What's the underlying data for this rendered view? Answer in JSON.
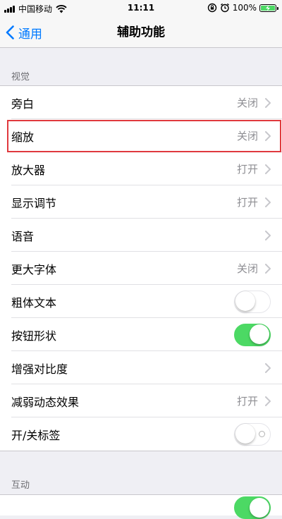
{
  "status_bar": {
    "carrier": "中国移动",
    "time": "11:11",
    "battery_percent": "100%",
    "icons": [
      "signal-icon",
      "wifi-icon",
      "rotation-lock-icon",
      "alarm-icon",
      "battery-charging-icon"
    ]
  },
  "nav": {
    "back_label": "通用",
    "title": "辅助功能"
  },
  "sections": {
    "vision_header": "视觉",
    "interaction_header": "互动"
  },
  "rows": [
    {
      "label": "旁白",
      "value": "关闭",
      "type": "disclosure"
    },
    {
      "label": "缩放",
      "value": "关闭",
      "type": "disclosure",
      "highlighted": true
    },
    {
      "label": "放大器",
      "value": "打开",
      "type": "disclosure"
    },
    {
      "label": "显示调节",
      "value": "打开",
      "type": "disclosure"
    },
    {
      "label": "语音",
      "value": "",
      "type": "disclosure"
    },
    {
      "label": "更大字体",
      "value": "关闭",
      "type": "disclosure"
    },
    {
      "label": "粗体文本",
      "type": "toggle",
      "on": false
    },
    {
      "label": "按钮形状",
      "type": "toggle",
      "on": true
    },
    {
      "label": "增强对比度",
      "value": "",
      "type": "disclosure"
    },
    {
      "label": "减弱动态效果",
      "value": "打开",
      "type": "disclosure"
    },
    {
      "label": "开/关标签",
      "type": "toggle",
      "on": false,
      "show_onoff_label": true
    }
  ],
  "colors": {
    "accent": "#007aff",
    "toggle_on": "#4cd964",
    "highlight_border": "#e0393e",
    "background": "#efeff4"
  }
}
